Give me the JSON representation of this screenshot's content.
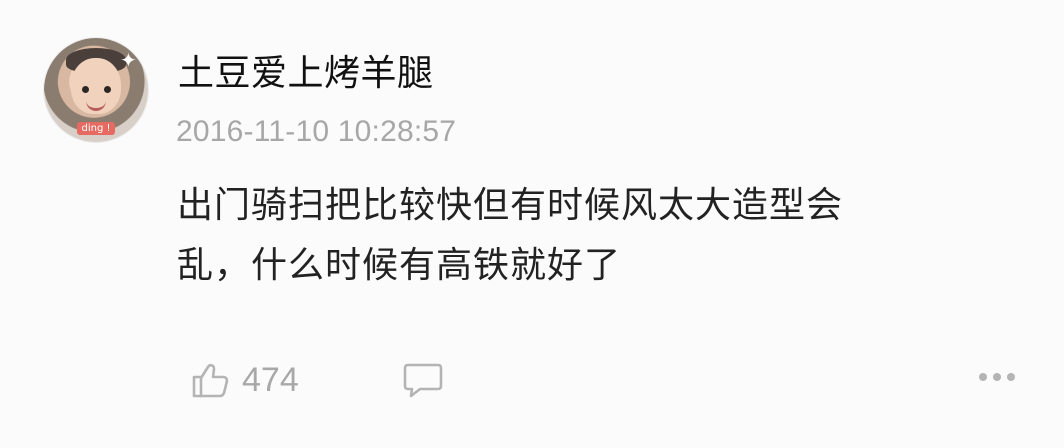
{
  "user": {
    "name": "土豆爱上烤羊腿",
    "avatar_badge": "ding !"
  },
  "comment": {
    "timestamp": "2016-11-10 10:28:57",
    "text": "出门骑扫把比较快但有时候风太大造型会\n乱，什么时候有高铁就好了"
  },
  "actions": {
    "like_count": "474",
    "like_icon": "thumbs-up-icon",
    "comment_icon": "speech-bubble-icon",
    "more_icon": "ellipsis-icon"
  },
  "colors": {
    "background": "#fbfbfb",
    "username": "#111111",
    "meta": "#a7a7a7",
    "text": "#222222"
  }
}
